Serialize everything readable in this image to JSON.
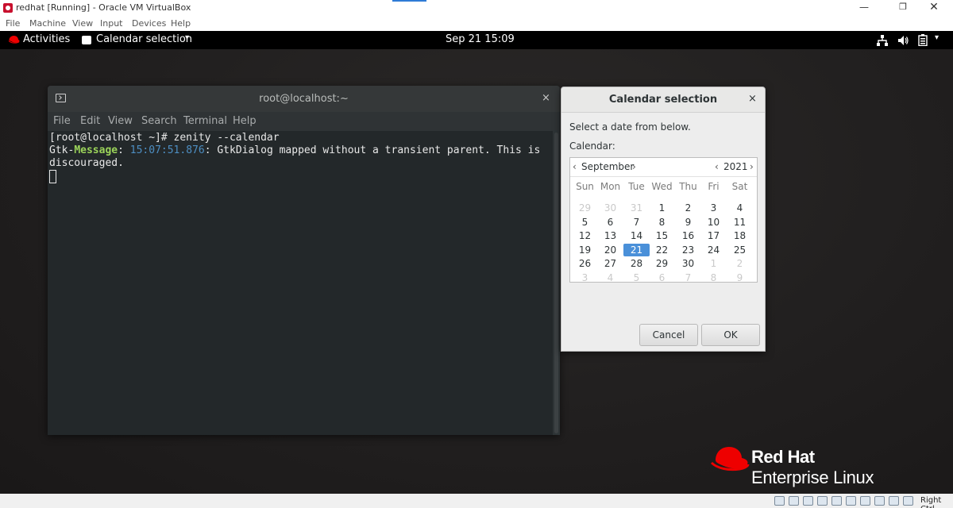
{
  "host": {
    "title": "redhat [Running] - Oracle VM VirtualBox",
    "window_controls": {
      "minimize": "—",
      "restore": "❐",
      "close": "✕"
    },
    "menu": [
      "File",
      "Machine",
      "View",
      "Input",
      "Devices",
      "Help"
    ],
    "host_key": "Right Ctrl",
    "status_icons": [
      "hard-disk-icon",
      "optical-drive-icon",
      "audio-icon",
      "network-icon",
      "usb-icon",
      "shared-folders-icon",
      "display-icon",
      "video-capture-icon",
      "cpu-icon",
      "keyboard-capture-icon",
      "mouse-integration-icon"
    ]
  },
  "gnome": {
    "activities": "Activities",
    "app_menu": "Calendar selection",
    "app_menu_arrow": "▾",
    "clock": "Sep 21  15:09",
    "system_menu_arrow": "▾"
  },
  "terminal": {
    "title": "root@localhost:~",
    "close": "×",
    "menu": [
      "File",
      "Edit",
      "View",
      "Search",
      "Terminal",
      "Help"
    ],
    "lines": {
      "prompt": "[root@localhost ~]# zenity --calendar",
      "msg_source": "Gtk-",
      "msg_tag": "Message",
      "msg_colon1": ": ",
      "msg_time": "15:07:51.876",
      "msg_text": ": GtkDialog mapped without a transient parent. This is",
      "msg_cont": "discouraged."
    }
  },
  "calendar_dialog": {
    "title": "Calendar selection",
    "close": "×",
    "prompt": "Select a date from below.",
    "label": "Calendar:",
    "month": "September",
    "year": "2021",
    "nav": {
      "prev": "‹",
      "next": "›"
    },
    "weekdays": [
      "Sun",
      "Mon",
      "Tue",
      "Wed",
      "Thu",
      "Fri",
      "Sat"
    ],
    "weeks": [
      [
        "29",
        "30",
        "31",
        "1",
        "2",
        "3",
        "4"
      ],
      [
        "5",
        "6",
        "7",
        "8",
        "9",
        "10",
        "11"
      ],
      [
        "12",
        "13",
        "14",
        "15",
        "16",
        "17",
        "18"
      ],
      [
        "19",
        "20",
        "21",
        "22",
        "23",
        "24",
        "25"
      ],
      [
        "26",
        "27",
        "28",
        "29",
        "30",
        "1",
        "2"
      ],
      [
        "3",
        "4",
        "5",
        "6",
        "7",
        "8",
        "9"
      ]
    ],
    "selected_day": "21",
    "cancel_label": "Cancel",
    "ok_label": "OK"
  },
  "branding": {
    "line1": "Red Hat",
    "line2": "Enterprise Linux"
  },
  "colors": {
    "selection": "#4a90d9",
    "message_tag": "#9bd35a",
    "message_time": "#4d8ec2",
    "redhat_red": "#ee0000"
  }
}
